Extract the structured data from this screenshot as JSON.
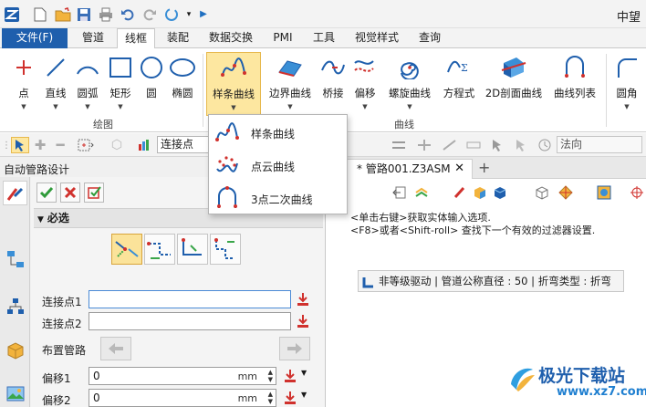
{
  "app_title": "中望",
  "menu": {
    "file": "文件(F)",
    "tabs": [
      "管道",
      "线框",
      "装配",
      "数据交换",
      "PMI",
      "工具",
      "视觉样式",
      "查询"
    ]
  },
  "ribbon": {
    "buttons": [
      "点",
      "直线",
      "圆弧",
      "矩形",
      "圆",
      "椭圆",
      "样条曲线",
      "边界曲线",
      "桥接",
      "偏移",
      "螺旋曲线",
      "方程式",
      "2D剖面曲线",
      "曲线列表",
      "圆角"
    ],
    "groups": {
      "draw": "绘图",
      "curve": "曲线"
    }
  },
  "toolbar": {
    "filter_value": "连接点",
    "direction_value": "法向"
  },
  "dropdown": {
    "items": [
      "样条曲线",
      "点云曲线",
      "3点二次曲线"
    ]
  },
  "panel": {
    "title": "自动管路设计",
    "section": "必选",
    "fields": {
      "conn1": "连接点1",
      "conn2": "连接点2",
      "layout": "布置管路",
      "offset1": "偏移1",
      "offset2": "偏移2",
      "offset1_value": "0",
      "offset2_value": "0",
      "unit": "mm"
    }
  },
  "doc": {
    "tab": "* 管路001.Z3ASM",
    "close": "✕",
    "add": "+",
    "prompt1": "<单击右键>获取实体输入选项.",
    "prompt2": "<F8>或者<Shift-roll> 查找下一个有效的过滤器设置.",
    "status": "非等级驱动 | 管道公称直径 : 50 | 折弯类型 : 折弯"
  },
  "watermark": {
    "name": "极光下载站",
    "url": "www.xz7.com"
  },
  "colors": {
    "accent": "#1f5fad",
    "selected": "#fde7a0",
    "red_icon": "#d0312d",
    "curve_blue": "#1f5fad",
    "curve_red": "#d0312d"
  }
}
